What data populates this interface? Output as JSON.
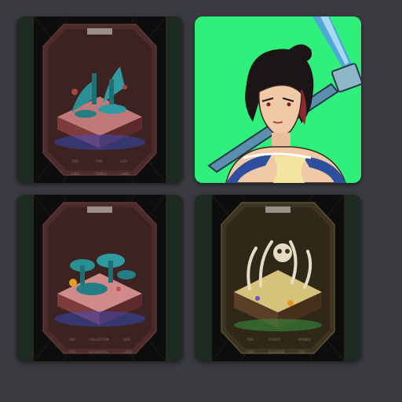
{
  "gallery": {
    "tiles": [
      {
        "kind": "land-card",
        "theme": "teal-ruins",
        "accent": "#2a8f95",
        "panel": "#4a2a2a",
        "labels": [
          "TIER",
          "TYPE",
          "SIZE",
          "TEMPLE",
          "KIND",
          "LAND"
        ]
      },
      {
        "kind": "character-portrait",
        "background": "#2ff07a",
        "weapon_color": "#4fa8d8"
      },
      {
        "kind": "land-card",
        "theme": "teal-swamp",
        "accent": "#2a8f95",
        "panel": "#4a2a2a",
        "labels": [
          "TIER",
          "COLLECTION",
          "SIZE",
          "TYPE",
          "RESOURCES",
          "LAND"
        ]
      },
      {
        "kind": "land-card",
        "theme": "bone-desert",
        "accent": "#b59a55",
        "panel": "#3d3422",
        "labels": [
          "TIER",
          "FOREST",
          "BIOMES",
          "TYPE",
          "BIG RIVER",
          "SIZE"
        ]
      }
    ]
  }
}
